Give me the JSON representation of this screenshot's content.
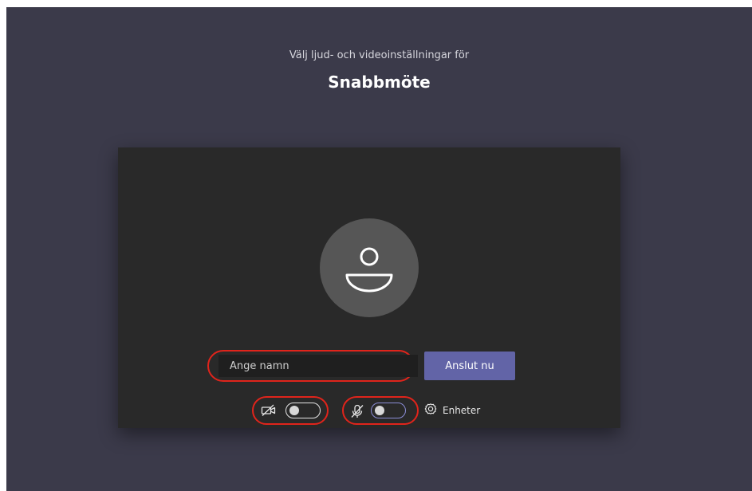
{
  "header": {
    "subtitle": "Välj ljud- och videoinställningar för",
    "meeting_title": "Snabbmöte"
  },
  "prejoin": {
    "avatar_icon": "person-icon",
    "name_input": {
      "value": "",
      "placeholder": "Ange namn"
    },
    "join_button_label": "Anslut nu",
    "video": {
      "icon": "camera-off-icon",
      "state": "off"
    },
    "mic": {
      "icon": "mic-off-icon",
      "state": "off"
    },
    "devices": {
      "icon": "gear-icon",
      "label": "Enheter"
    }
  },
  "colors": {
    "background": "#3b3a4a",
    "panel": "#292929",
    "accent": "#6264a7",
    "highlight": "#e0241b"
  }
}
